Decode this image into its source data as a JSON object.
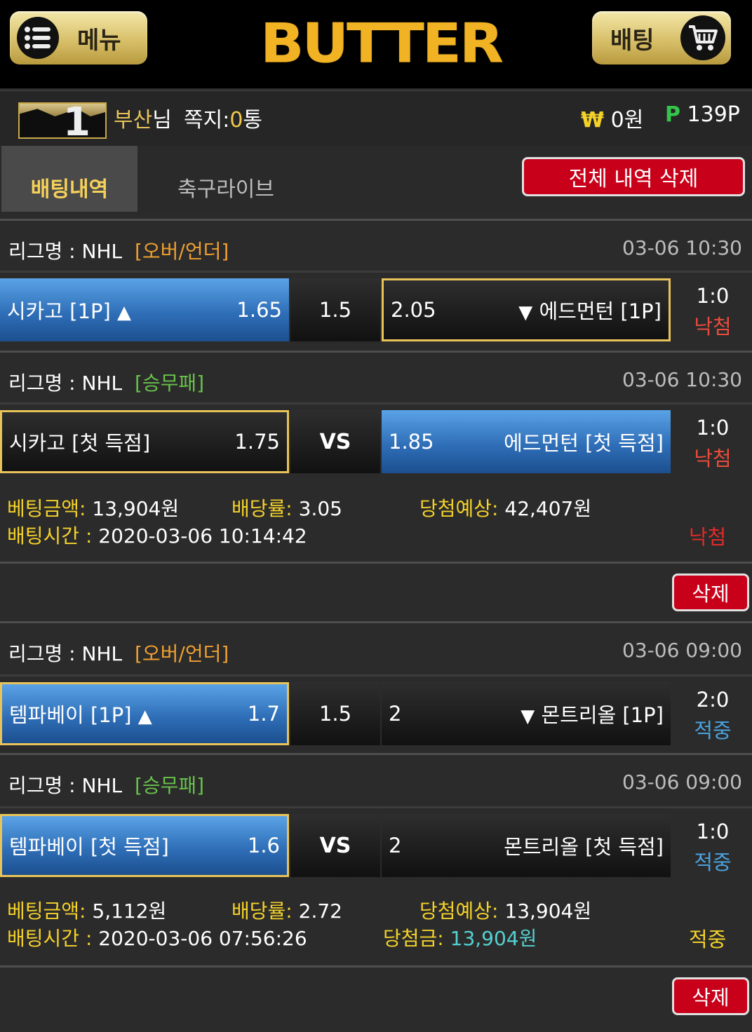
{
  "header": {
    "menu_label": "메뉴",
    "logo_text": "BUTTER",
    "bet_label": "배팅",
    "menu_icon": "list-icon",
    "cart_icon": "cart-icon"
  },
  "user": {
    "level": "1",
    "name_prefix": "부산",
    "name_suffix": "님",
    "memo_label": "쪽지:",
    "memo_count": "0",
    "memo_unit": "통",
    "won_symbol": "₩",
    "money": "0원",
    "point_symbol": "P",
    "points": "139P"
  },
  "tabs": {
    "active": "배팅내역",
    "inactive": "축구라이브",
    "delete_all": "전체 내역 삭제"
  },
  "bets": [
    {
      "rows": [
        {
          "league_label": "리그명 : NHL",
          "tag": "[오버/언더]",
          "time": "03-06 10:30",
          "home_team": "시카고 [1P]",
          "home_arrow": "▲",
          "home_odds": "1.65",
          "mid": "1.5",
          "away_odds": "2.05",
          "away_arrow": "▼",
          "away_team": "에드먼턴 [1P]",
          "score": "1:0",
          "status": "낙첨"
        },
        {
          "league_label": "리그명 : NHL",
          "tag": "[승무패]",
          "time": "03-06 10:30",
          "home_team": "시카고 [첫 득점]",
          "home_odds": "1.75",
          "mid": "VS",
          "away_odds": "1.85",
          "away_team": "에드먼턴 [첫 득점]",
          "score": "1:0",
          "status": "낙첨"
        }
      ],
      "summary": {
        "amount_label": "베팅금액:",
        "amount": "13,904원",
        "rate_label": "배당률:",
        "rate": "3.05",
        "expected_label": "당첨예상:",
        "expected": "42,407원",
        "time_label": "배팅시간 :",
        "time": "2020-03-06 10:14:42",
        "status": "낙첨"
      },
      "delete_label": "삭제"
    },
    {
      "rows": [
        {
          "league_label": "리그명 : NHL",
          "tag": "[오버/언더]",
          "time": "03-06 09:00",
          "home_team": "템파베이 [1P]",
          "home_arrow": "▲",
          "home_odds": "1.7",
          "mid": "1.5",
          "away_odds": "2",
          "away_arrow": "▼",
          "away_team": "몬트리올 [1P]",
          "score": "2:0",
          "status": "적중"
        },
        {
          "league_label": "리그명 : NHL",
          "tag": "[승무패]",
          "time": "03-06 09:00",
          "home_team": "템파베이 [첫 득점]",
          "home_odds": "1.6",
          "mid": "VS",
          "away_odds": "2",
          "away_team": "몬트리올 [첫 득점]",
          "score": "1:0",
          "status": "적중"
        }
      ],
      "summary": {
        "amount_label": "베팅금액:",
        "amount": "5,112원",
        "rate_label": "배당률:",
        "rate": "2.72",
        "expected_label": "당첨예상:",
        "expected": "13,904원",
        "time_label": "배팅시간 :",
        "time": "2020-03-06 07:56:26",
        "prize_label": "당첨금:",
        "prize": "13,904원",
        "status": "적중"
      },
      "delete_label": "삭제"
    }
  ],
  "colors": {
    "gold": "#e8c35a",
    "blue_selection": "#3a82cf",
    "lose_red": "#e74c3c",
    "win_blue": "#4aa3e0",
    "delete_red": "#c8001a"
  }
}
